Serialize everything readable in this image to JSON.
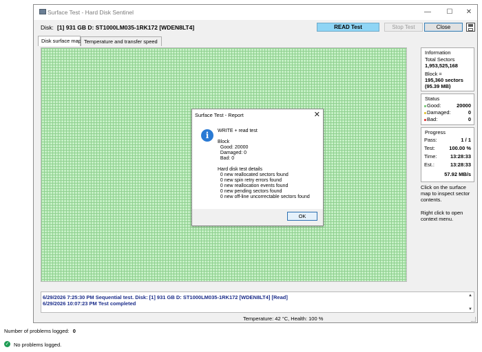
{
  "window": {
    "title": "Surface Test - Hard Disk Sentinel",
    "controls": {
      "minimize": "—",
      "maximize": "☐",
      "close": "✕"
    }
  },
  "toolbar": {
    "disk_label": "Disk:",
    "disk_name": "[1] 931 GB D: ST1000LM035-1RK172 [WDEN8LT4]",
    "read_test_label": "READ Test",
    "stop_test_label": "Stop Test",
    "close_label": "Close"
  },
  "tabs": [
    {
      "label": "Disk surface map",
      "active": true
    },
    {
      "label": "Temperature and transfer speed",
      "active": false
    }
  ],
  "info": {
    "title": "Information",
    "total_label": "Total Sectors",
    "total_value": "1,953,525,168",
    "block_label": "Block =",
    "block_value": "195,360 sectors",
    "block_size": "(95.39 MB)"
  },
  "status": {
    "title": "Status",
    "items": [
      {
        "label": "Good:",
        "value": "20000",
        "color": "#7fcf7f"
      },
      {
        "label": "Damaged:",
        "value": "0",
        "color": "#e6c84a"
      },
      {
        "label": "Bad:",
        "value": "0",
        "color": "#e24a4a"
      }
    ]
  },
  "progress": {
    "title": "Progress",
    "rows": [
      {
        "label": "Pass:",
        "value": "1 / 1"
      },
      {
        "label": "Test:",
        "value": "100.00 %"
      },
      {
        "label": "Time:",
        "value": "13:28:33"
      },
      {
        "label": "Est.:",
        "value": "13:28:33"
      }
    ],
    "speed": "57.92 MB/s"
  },
  "hints": {
    "surface": "Click on the surface map to inspect sector contents.",
    "context": "Right click to open context menu."
  },
  "log": [
    "6/29/2026  7:25:30 PM   Sequential test. Disk: [1] 931 GB D: ST1000LM035-1RK172 [WDEN8LT4] [Read]",
    "6/29/2026  10:07:23 PM   Test completed"
  ],
  "statusbar": {
    "text": "Temperature: 42  °C,  Health: 100 %"
  },
  "dialog": {
    "title": "Surface Test - Report",
    "body": "WRITE + read test\n\nBlock\n  Good: 20000\n  Damaged: 0\n  Bad: 0\n\nHard disk test details\n  0 new reallocated sectors found\n  0 new spin retry errors found\n  0 new reallocation events found\n  0 new pending sectors found\n  0 new off-line uncorrectable sectors found",
    "ok_label": "OK",
    "icon": "information-icon"
  },
  "footer": {
    "problems_label": "Number of problems logged:",
    "problems_count": "0",
    "no_problems": "No problems logged."
  },
  "colors": {
    "map_fill": "#c6f0c6",
    "map_grid": "#8fd08f",
    "read_button": "#8fd5f5",
    "log_text": "#1a2c8a",
    "ok_check": "#1f9d55"
  }
}
